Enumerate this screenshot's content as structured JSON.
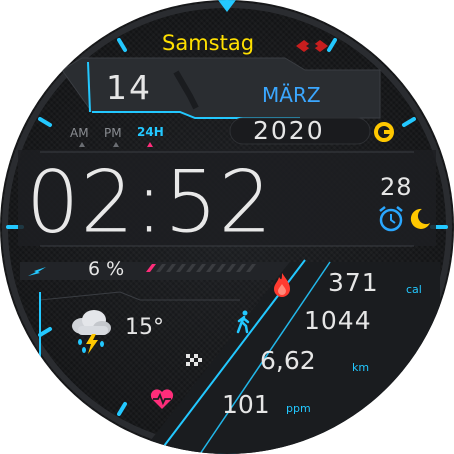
{
  "watch": {
    "day_name": "Samstag",
    "date": "14",
    "month": "MÄRZ",
    "year": "2020",
    "time_format": {
      "am": "AM",
      "pm": "PM",
      "h24": "24H",
      "active": "24H"
    },
    "time": "02:52",
    "seconds": "28",
    "battery_percent_text": "6 %",
    "battery_level": 0.06,
    "weather": {
      "temperature": "15°",
      "condition_icon": "thunderstorm-cloud-icon"
    },
    "stats": {
      "calories": "371",
      "calories_unit": "cal",
      "steps": "1044",
      "distance": "6,62",
      "distance_unit": "km",
      "heart_rate": "101",
      "heart_rate_unit": "ppm"
    },
    "colors": {
      "accent_cyan": "#23c8ff",
      "day_yellow": "#ffe000",
      "month_blue": "#3ba7ff",
      "battery_pink": "#ff2d7a",
      "heart_pink": "#ff2d7a",
      "flame_red": "#ff3b30",
      "alarm_blue": "#2aa7ff",
      "moon_yellow": "#ffc800"
    },
    "icons": [
      "lightning-icon",
      "thunderstorm-cloud-icon",
      "flame-icon",
      "walking-person-icon",
      "finish-flag-icon",
      "heart-pulse-icon",
      "alarm-clock-icon",
      "moon-icon",
      "logo-icon",
      "g-badge-icon"
    ]
  }
}
